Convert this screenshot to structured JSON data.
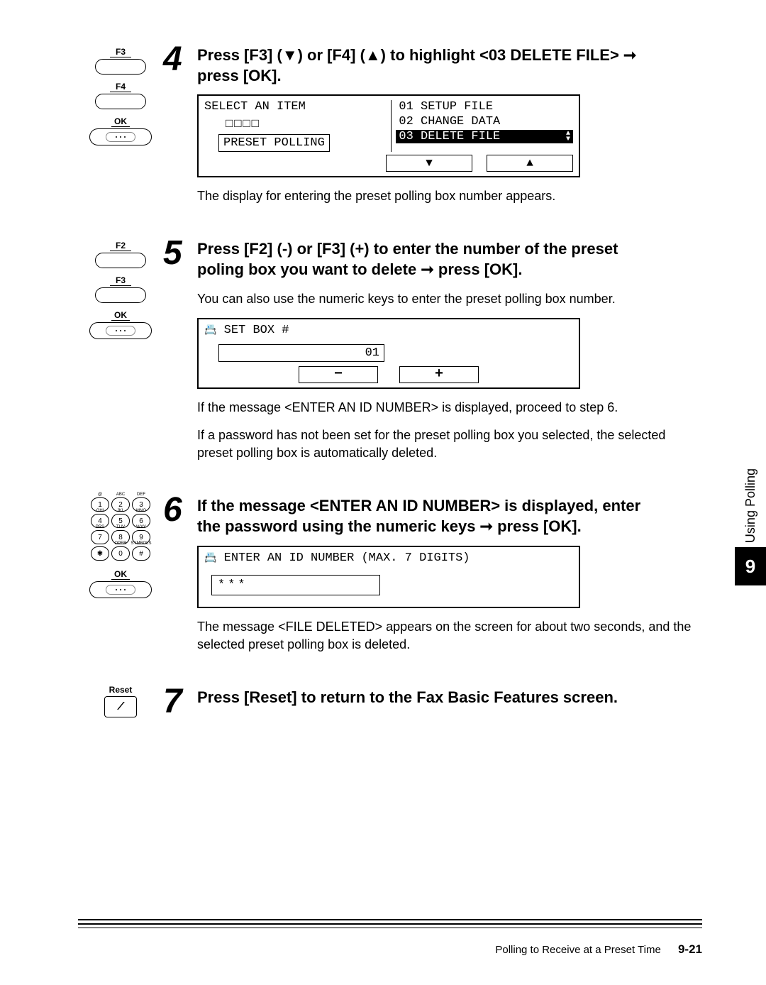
{
  "step4": {
    "num": "4",
    "heading_a": "Press [F3] (▼) or [F4] (▲) to highlight <03 DELETE FILE> ➞",
    "heading_b": "press [OK].",
    "keys": {
      "f3": "F3",
      "f4": "F4",
      "ok": "OK"
    },
    "lcd": {
      "left_top": "SELECT AN ITEM",
      "left_squares": "□□□□",
      "left_box": "PRESET POLLING",
      "right_items": [
        "01  SETUP FILE",
        "02  CHANGE DATA"
      ],
      "right_highlight": "03  DELETE FILE",
      "arrow_down": "▼",
      "arrow_up": "▲"
    },
    "caption": "The display for entering the preset polling box number appears."
  },
  "step5": {
    "num": "5",
    "heading_a": "Press [F2] (-) or [F3] (+) to enter the number of the preset",
    "heading_b": "poling box you want to delete ➞ press [OK].",
    "keys": {
      "f2": "F2",
      "f3": "F3",
      "ok": "OK"
    },
    "pre_text": "You can also use the numeric keys to enter the preset polling box number.",
    "lcd": {
      "title_icon": "📇",
      "title": "SET BOX #",
      "value": "01",
      "minus": "−",
      "plus": "+"
    },
    "post_text_a": "If the message <ENTER AN ID NUMBER> is displayed, proceed to step 6.",
    "post_text_b": "If a password has not been set for the preset polling box you selected, the selected preset polling box is automatically deleted."
  },
  "step6": {
    "num": "6",
    "heading_a": "If the message <ENTER AN ID NUMBER> is displayed, enter",
    "heading_b": "the password using the numeric keys ➞ press [OK].",
    "keys": {
      "ok": "OK"
    },
    "numpad_labels": [
      "@",
      "ABC",
      "DEF",
      "GHI",
      "JKL",
      "MNO",
      "PRS",
      "TUV",
      "WXY",
      "",
      "OPER",
      "SYMBOLS"
    ],
    "numpad_keys": [
      "1",
      "2",
      "3",
      "4",
      "5",
      "6",
      "7",
      "8",
      "9",
      "✱",
      "0",
      "#"
    ],
    "lcd": {
      "title_icon": "📇",
      "title": "ENTER AN ID NUMBER (MAX. 7 DIGITS)",
      "value": "***"
    },
    "post_text": "The message <FILE DELETED> appears on the screen for about two seconds, and the selected preset polling box is deleted."
  },
  "step7": {
    "num": "7",
    "heading": "Press [Reset] to return to the Fax Basic Features screen.",
    "key_label": "Reset"
  },
  "side": {
    "text": "Using Polling",
    "num": "9"
  },
  "footer": {
    "title": "Polling to Receive at a Preset Time",
    "page": "9-21"
  }
}
